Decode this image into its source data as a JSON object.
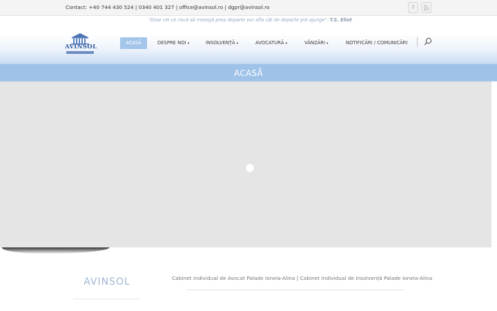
{
  "topbar": {
    "contact": "Contact: +40 744 430 524 | 0340 401 327 | office@avinsol.ro | dgpr@avinsol.ro",
    "social": [
      {
        "icon": "facebook-icon",
        "glyph": "f"
      },
      {
        "icon": "rss-icon",
        "glyph": "⊃"
      }
    ]
  },
  "header": {
    "quote_text": "\"Doar cei ce riscă să meargă prea departe vor afla cât de departe pot ajunge\". ",
    "quote_author": "T.S. Eliot",
    "logo_text": "AVINSOL"
  },
  "nav": {
    "items": [
      {
        "label": "ACASĂ",
        "active": true
      },
      {
        "label": "DESPRE NOI",
        "dropdown": true
      },
      {
        "label": "INSOLVENȚĂ",
        "dropdown": true
      },
      {
        "label": "AVOCATURĂ",
        "dropdown": true
      },
      {
        "label": "VÂNZĂRI",
        "dropdown": true
      },
      {
        "label": "NOTIFICĂRI / COMUNICĂRI",
        "dropdown": false
      }
    ],
    "chevron": "▾"
  },
  "page": {
    "title": "ACASĂ"
  },
  "footer": {
    "brand": "AVINSOL",
    "tagline": "Cabinet Individual de Avocat Palade Ionela-Alina | Cabinet Individual de Insolvență Palade Ionela-Alina"
  },
  "colors": {
    "accent": "#9ec2e8",
    "nav_active": "#a4c5ea",
    "brand_blue": "#2d5aa0"
  }
}
